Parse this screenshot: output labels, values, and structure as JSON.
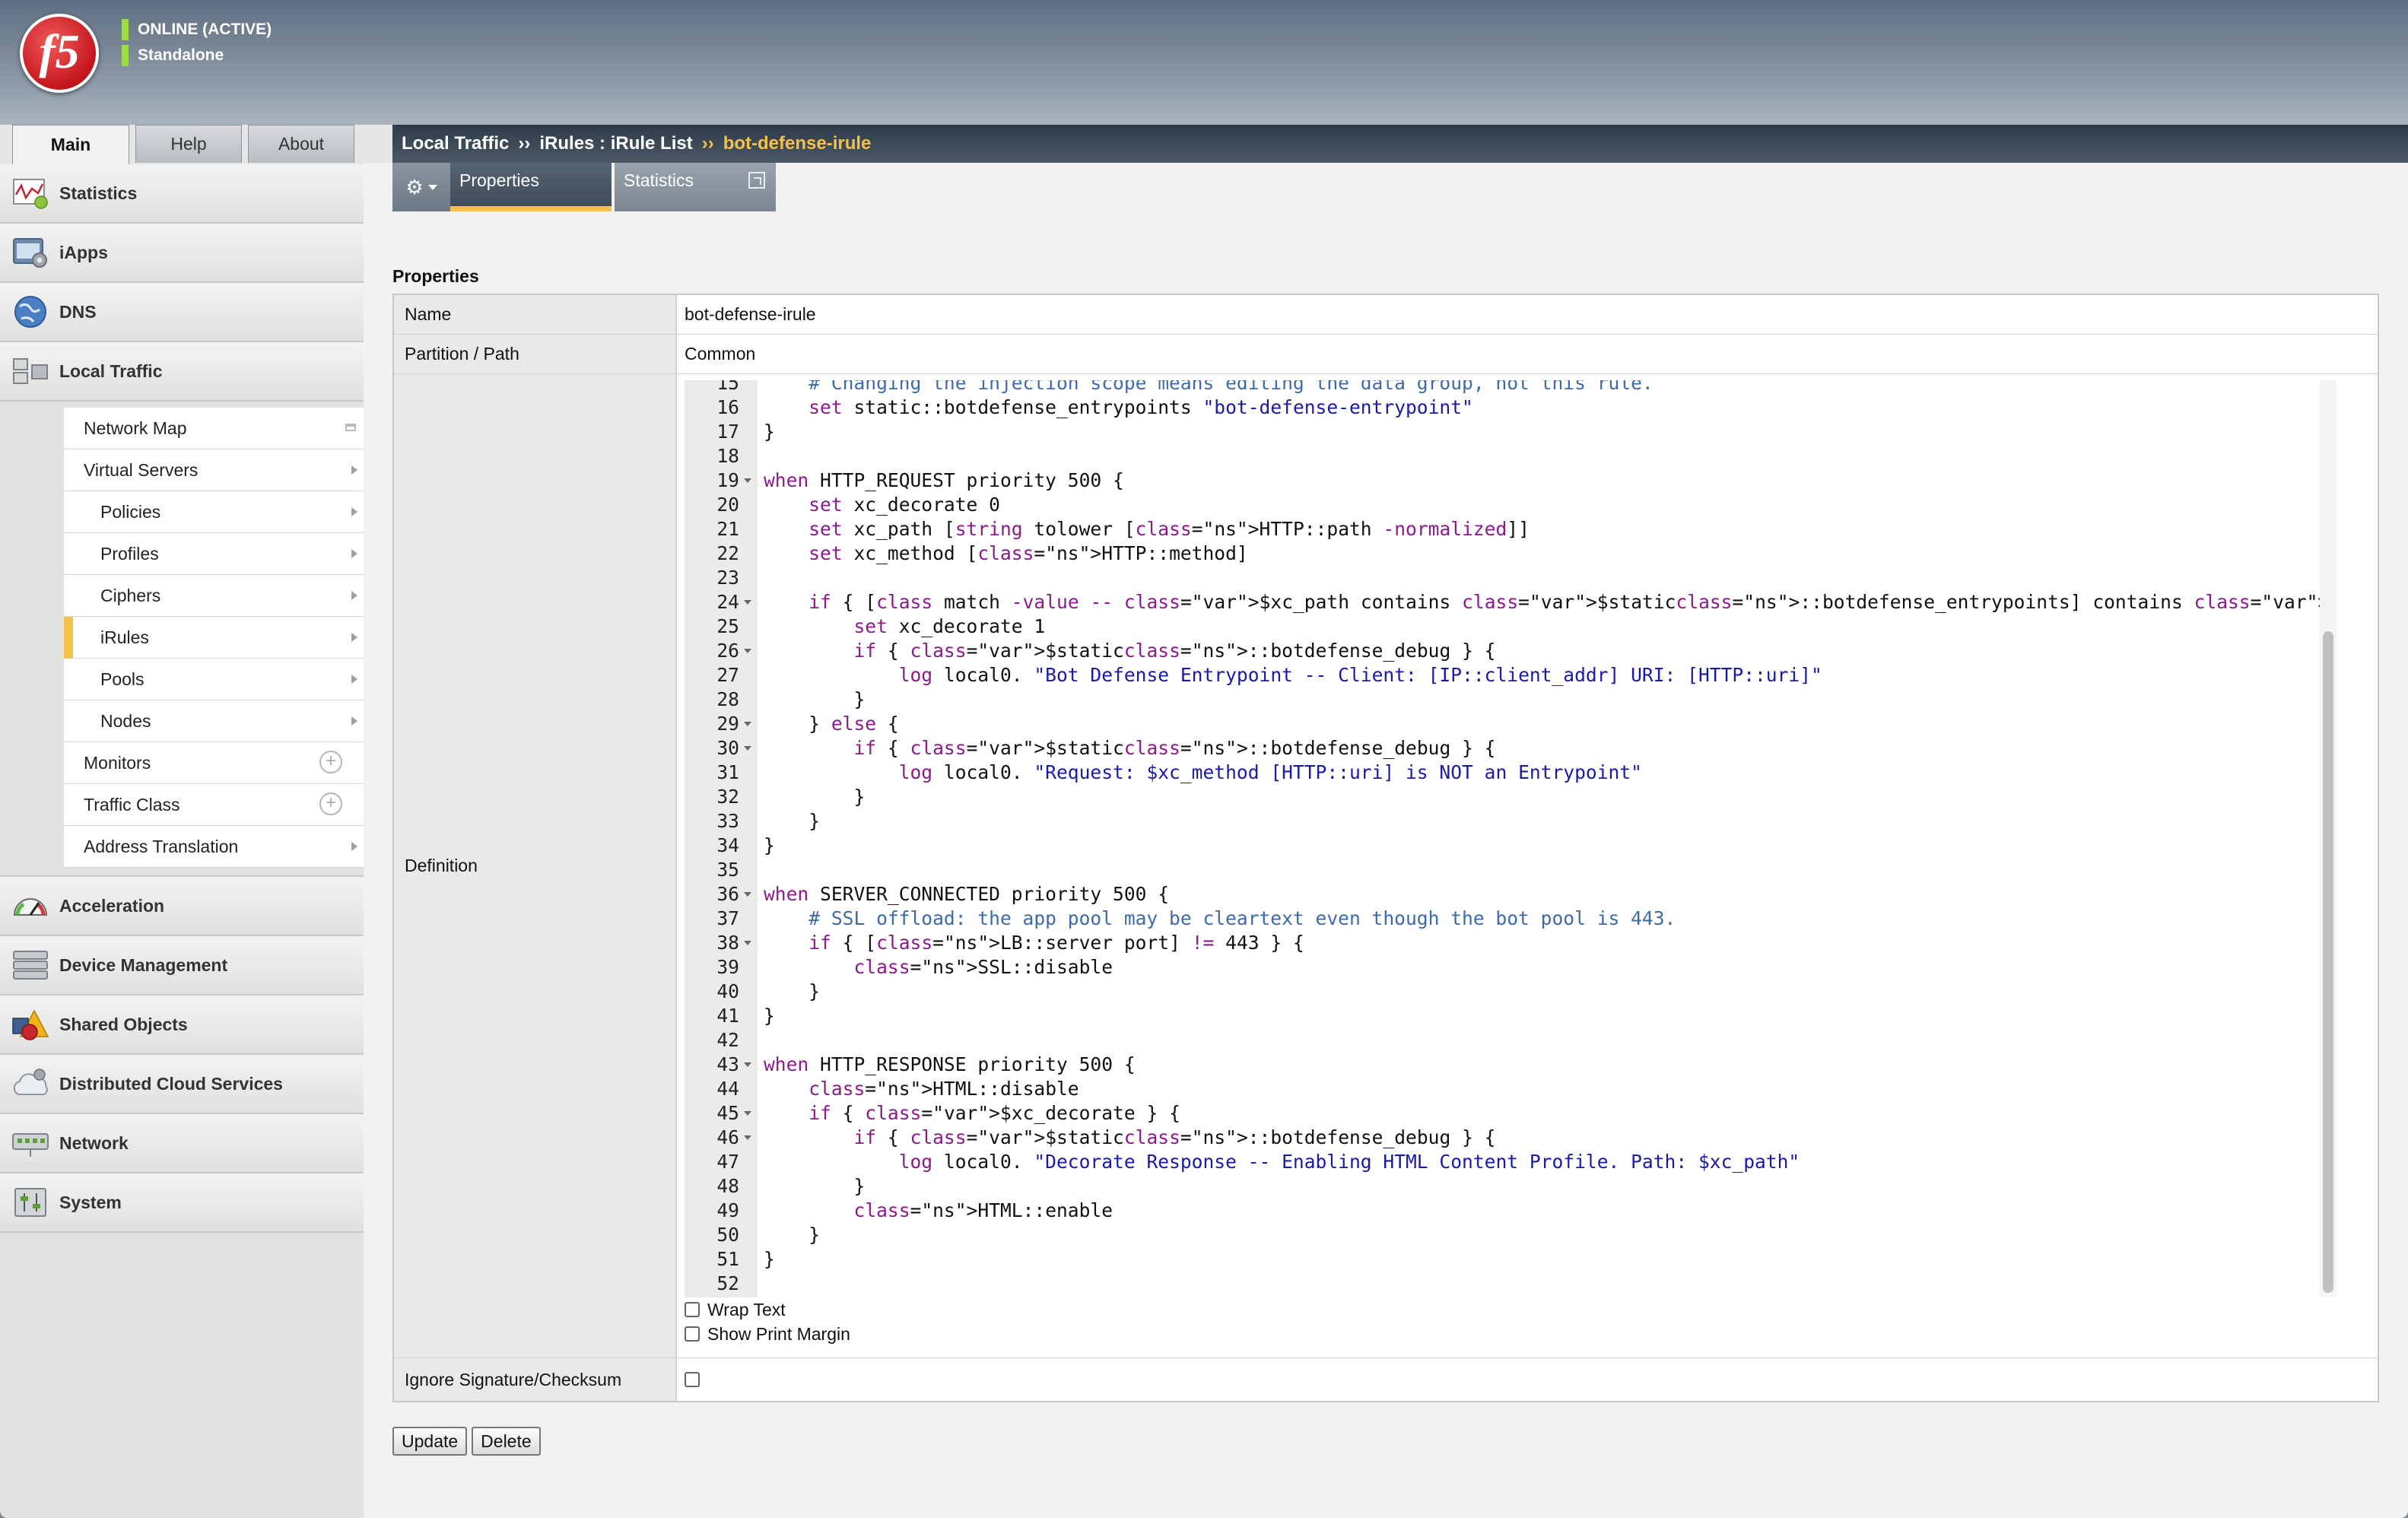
{
  "header": {
    "logo_text": "f5",
    "status_primary": "ONLINE (ACTIVE)",
    "status_secondary": "Standalone"
  },
  "main_tabs": [
    {
      "label": "Main",
      "active": true
    },
    {
      "label": "Help",
      "active": false
    },
    {
      "label": "About",
      "active": false
    }
  ],
  "breadcrumb": {
    "part1": "Local Traffic",
    "sep1": "››",
    "part2": "iRules : iRule List",
    "sep2": "››",
    "current": "bot-defense-irule"
  },
  "sidebar": {
    "sections_top": [
      {
        "label": "Statistics",
        "icon": "statistics-icon"
      },
      {
        "label": "iApps",
        "icon": "iapps-icon"
      },
      {
        "label": "DNS",
        "icon": "globe-icon"
      },
      {
        "label": "Local Traffic",
        "icon": "local-traffic-icon"
      }
    ],
    "local_traffic_items": [
      {
        "label": "Network Map",
        "indent": false,
        "selected": false
      },
      {
        "label": "Virtual Servers",
        "indent": false,
        "selected": false
      },
      {
        "label": "Policies",
        "indent": true,
        "selected": false
      },
      {
        "label": "Profiles",
        "indent": true,
        "selected": false
      },
      {
        "label": "Ciphers",
        "indent": true,
        "selected": false
      },
      {
        "label": "iRules",
        "indent": true,
        "selected": true
      },
      {
        "label": "Pools",
        "indent": true,
        "selected": false
      },
      {
        "label": "Nodes",
        "indent": true,
        "selected": false
      },
      {
        "label": "Monitors",
        "indent": false,
        "selected": false
      },
      {
        "label": "Traffic Class",
        "indent": false,
        "selected": false
      },
      {
        "label": "Address Translation",
        "indent": false,
        "selected": false
      }
    ],
    "sections_bottom": [
      {
        "label": "Acceleration",
        "icon": "gauge-icon"
      },
      {
        "label": "Device Management",
        "icon": "device-icon"
      },
      {
        "label": "Shared Objects",
        "icon": "shapes-icon"
      },
      {
        "label": "Distributed Cloud Services",
        "icon": "cloud-icon"
      },
      {
        "label": "Network",
        "icon": "network-icon"
      },
      {
        "label": "System",
        "icon": "system-icon"
      }
    ]
  },
  "subtabs": {
    "properties": "Properties",
    "statistics": "Statistics"
  },
  "properties": {
    "section_title": "Properties",
    "name_label": "Name",
    "name_value": "bot-defense-irule",
    "partition_label": "Partition / Path",
    "partition_value": "Common",
    "definition_label": "Definition",
    "ignore_label": "Ignore Signature/Checksum"
  },
  "editor": {
    "lines": [
      {
        "n": "15",
        "fold": false,
        "code": "    # Changing the injection scope means editing the data group, not this rule."
      },
      {
        "n": "16",
        "fold": false,
        "code": "    set static::botdefense_entrypoints \"bot-defense-entrypoint\""
      },
      {
        "n": "17",
        "fold": false,
        "code": "}"
      },
      {
        "n": "18",
        "fold": false,
        "code": ""
      },
      {
        "n": "19",
        "fold": true,
        "code": "when HTTP_REQUEST priority 500 {"
      },
      {
        "n": "20",
        "fold": false,
        "code": "    set xc_decorate 0"
      },
      {
        "n": "21",
        "fold": false,
        "code": "    set xc_path [string tolower [HTTP::path -normalized]]"
      },
      {
        "n": "22",
        "fold": false,
        "code": "    set xc_method [HTTP::method]"
      },
      {
        "n": "23",
        "fold": false,
        "code": ""
      },
      {
        "n": "24",
        "fold": true,
        "code": "    if { [class match -value -- $xc_path contains $static::botdefense_entrypoints] contains $xc_method } {"
      },
      {
        "n": "25",
        "fold": false,
        "code": "        set xc_decorate 1"
      },
      {
        "n": "26",
        "fold": true,
        "code": "        if { $static::botdefense_debug } {"
      },
      {
        "n": "27",
        "fold": false,
        "code": "            log local0. \"Bot Defense Entrypoint -- Client: [IP::client_addr] URI: [HTTP::uri]\""
      },
      {
        "n": "28",
        "fold": false,
        "code": "        }"
      },
      {
        "n": "29",
        "fold": true,
        "code": "    } else {"
      },
      {
        "n": "30",
        "fold": true,
        "code": "        if { $static::botdefense_debug } {"
      },
      {
        "n": "31",
        "fold": false,
        "code": "            log local0. \"Request: $xc_method [HTTP::uri] is NOT an Entrypoint\""
      },
      {
        "n": "32",
        "fold": false,
        "code": "        }"
      },
      {
        "n": "33",
        "fold": false,
        "code": "    }"
      },
      {
        "n": "34",
        "fold": false,
        "code": "}"
      },
      {
        "n": "35",
        "fold": false,
        "code": ""
      },
      {
        "n": "36",
        "fold": true,
        "code": "when SERVER_CONNECTED priority 500 {"
      },
      {
        "n": "37",
        "fold": false,
        "code": "    # SSL offload: the app pool may be cleartext even though the bot pool is 443."
      },
      {
        "n": "38",
        "fold": true,
        "code": "    if { [LB::server port] != 443 } {"
      },
      {
        "n": "39",
        "fold": false,
        "code": "        SSL::disable"
      },
      {
        "n": "40",
        "fold": false,
        "code": "    }"
      },
      {
        "n": "41",
        "fold": false,
        "code": "}"
      },
      {
        "n": "42",
        "fold": false,
        "code": ""
      },
      {
        "n": "43",
        "fold": true,
        "code": "when HTTP_RESPONSE priority 500 {"
      },
      {
        "n": "44",
        "fold": false,
        "code": "    HTML::disable"
      },
      {
        "n": "45",
        "fold": true,
        "code": "    if { $xc_decorate } {"
      },
      {
        "n": "46",
        "fold": true,
        "code": "        if { $static::botdefense_debug } {"
      },
      {
        "n": "47",
        "fold": false,
        "code": "            log local0. \"Decorate Response -- Enabling HTML Content Profile. Path: $xc_path\""
      },
      {
        "n": "48",
        "fold": false,
        "code": "        }"
      },
      {
        "n": "49",
        "fold": false,
        "code": "        HTML::enable"
      },
      {
        "n": "50",
        "fold": false,
        "code": "    }"
      },
      {
        "n": "51",
        "fold": false,
        "code": "}"
      },
      {
        "n": "52",
        "fold": false,
        "code": ""
      }
    ],
    "wrap_text_label": "Wrap Text",
    "print_margin_label": "Show Print Margin"
  },
  "buttons": {
    "update": "Update",
    "delete": "Delete"
  },
  "colors": {
    "accent": "#f4c24a",
    "status_green": "#9ddc45",
    "keyword": "#8b1a8b",
    "string": "#1a1aa6",
    "comment": "#3d6aa8"
  }
}
